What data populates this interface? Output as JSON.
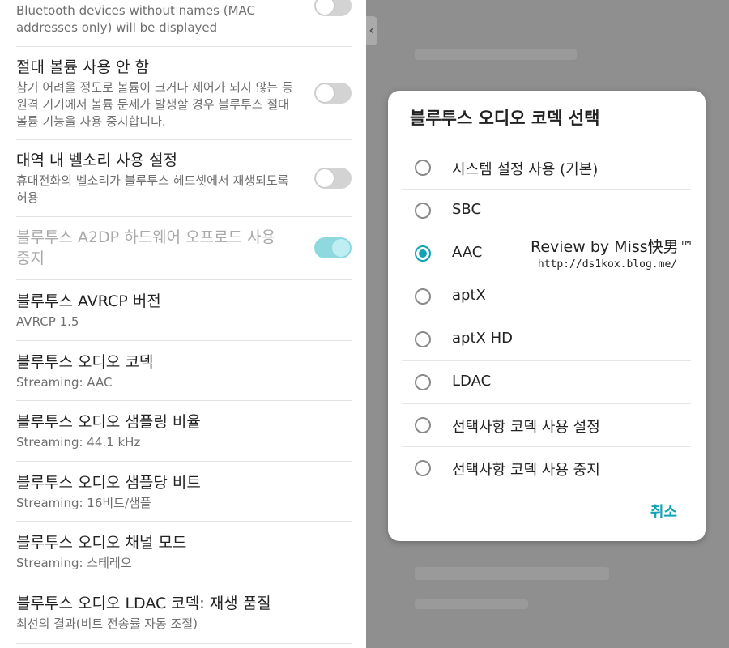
{
  "settings": {
    "rows": [
      {
        "title": "",
        "subtitle": "Bluetooth devices without names (MAC addresses only) will be displayed",
        "toggle": "off"
      },
      {
        "title": "절대 볼륨 사용 안 함",
        "subtitle": "참기 어려울 정도로 볼륨이 크거나 제어가 되지 않는 등 원격 기기에서 볼륨 문제가 발생할 경우 블루투스 절대 볼륨 기능을 사용 중지합니다.",
        "toggle": "off"
      },
      {
        "title": "대역 내 벨소리 사용 설정",
        "subtitle": "휴대전화의 벨소리가 블루투스 헤드셋에서 재생되도록 허용",
        "toggle": "off"
      },
      {
        "title": "블루투스 A2DP 하드웨어 오프로드 사용 중지",
        "subtitle": "",
        "toggle": "on",
        "disabled": true
      },
      {
        "title": "블루투스 AVRCP 버전",
        "subtitle": "AVRCP 1.5"
      },
      {
        "title": "블루투스 오디오 코덱",
        "subtitle": "Streaming: AAC"
      },
      {
        "title": "블루투스 오디오 샘플링 비율",
        "subtitle": "Streaming: 44.1 kHz"
      },
      {
        "title": "블루투스 오디오 샘플당 비트",
        "subtitle": "Streaming: 16비트/샘플"
      },
      {
        "title": "블루투스 오디오 채널 모드",
        "subtitle": "Streaming: 스테레오"
      },
      {
        "title": "블루투스 오디오 LDAC 코덱: 재생 품질",
        "subtitle": "최선의 결과(비트 전송률 자동 조절)"
      }
    ]
  },
  "dialog": {
    "title": "블루투스 오디오 코덱 선택",
    "options": [
      {
        "label": "시스템 설정 사용 (기본)",
        "checked": false
      },
      {
        "label": "SBC",
        "checked": false
      },
      {
        "label": "AAC",
        "checked": true
      },
      {
        "label": "aptX",
        "checked": false
      },
      {
        "label": "aptX HD",
        "checked": false
      },
      {
        "label": "LDAC",
        "checked": false
      },
      {
        "label": "선택사항 코덱 사용 설정",
        "checked": false
      },
      {
        "label": "선택사항 코덱 사용 중지",
        "checked": false
      }
    ],
    "cancel_label": "취소"
  },
  "watermark": {
    "line1": "Review by Miss快男™",
    "line2": "http://ds1kox.blog.me/"
  },
  "colors": {
    "accent": "#11a3b3",
    "toggle_on": "#8ed9e0",
    "toggle_off": "#d3d3d3",
    "disabled_text": "#a9a9a9"
  }
}
